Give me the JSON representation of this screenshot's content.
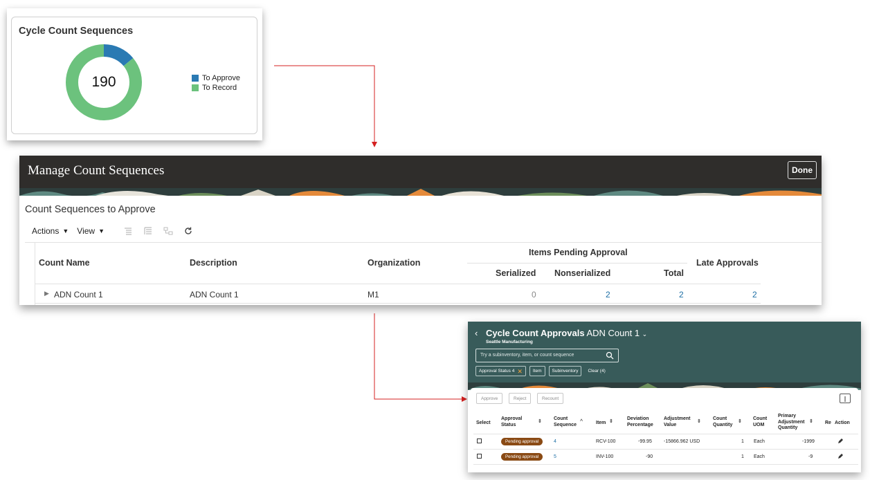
{
  "card1": {
    "title": "Cycle Count Sequences",
    "total": "190",
    "legend": [
      {
        "label": "To Approve",
        "color": "#2a7ab3"
      },
      {
        "label": "To Record",
        "color": "#6cc27d"
      }
    ]
  },
  "chart_data": {
    "type": "pie",
    "title": "Cycle Count Sequences",
    "center_label": "190",
    "slices": [
      {
        "name": "To Approve",
        "value": 0.14,
        "color": "#2a7ab3"
      },
      {
        "name": "To Record",
        "value": 0.86,
        "color": "#6cc27d"
      }
    ],
    "legend": "right"
  },
  "manage": {
    "title": "Manage Count Sequences",
    "done_label": "Done",
    "section_title": "Count Sequences to Approve",
    "toolbar": {
      "actions": "Actions",
      "view": "View"
    },
    "headers": {
      "count_name": "Count Name",
      "description": "Description",
      "organization": "Organization",
      "items_pending": "Items Pending Approval",
      "serialized": "Serialized",
      "nonserialized": "Nonserialized",
      "total": "Total",
      "late": "Late Approvals"
    },
    "rows": [
      {
        "count_name": "ADN Count 1",
        "description": "ADN Count 1",
        "organization": "M1",
        "serialized": "0",
        "nonserialized": "2",
        "total": "2",
        "late": "2"
      }
    ]
  },
  "approvals": {
    "title_bold": "Cycle Count Approvals",
    "title_rest": "ADN Count 1",
    "subtitle": "Seattle Manufacturing",
    "search_placeholder": "Try a subinventory, item, or count sequence",
    "chips": {
      "approval_status": "Approval Status 4",
      "item": "Item",
      "subinventory": "Subinventory",
      "clear": "Clear (4)"
    },
    "buttons": {
      "approve": "Approve",
      "reject": "Reject",
      "recount": "Recount"
    },
    "headers": {
      "select": "Select",
      "approval_status_1": "Approval",
      "approval_status_2": "Status",
      "count_sequence_1": "Count",
      "count_sequence_2": "Sequence",
      "item": "Item",
      "deviation_1": "Deviation",
      "deviation_2": "Percentage",
      "adjustment_1": "Adjustment",
      "adjustment_2": "Value",
      "count_qty_1": "Count",
      "count_qty_2": "Quantity",
      "count_uom_1": "Count",
      "count_uom_2": "UOM",
      "primary_1": "Primary",
      "primary_2": "Adjustment",
      "primary_3": "Quantity",
      "truncated": "Re",
      "action": "Action"
    },
    "rows": [
      {
        "status": "Pending approval",
        "sequence": "4",
        "item": "RCV-100",
        "deviation": "-99.95",
        "adjustment": "-15866.962 USD",
        "count_qty": "1",
        "uom": "Each",
        "primary_adj": "-1999"
      },
      {
        "status": "Pending approval",
        "sequence": "5",
        "item": "INV-100",
        "deviation": "-90",
        "adjustment": "",
        "count_qty": "1",
        "uom": "Each",
        "primary_adj": "-9"
      }
    ]
  }
}
